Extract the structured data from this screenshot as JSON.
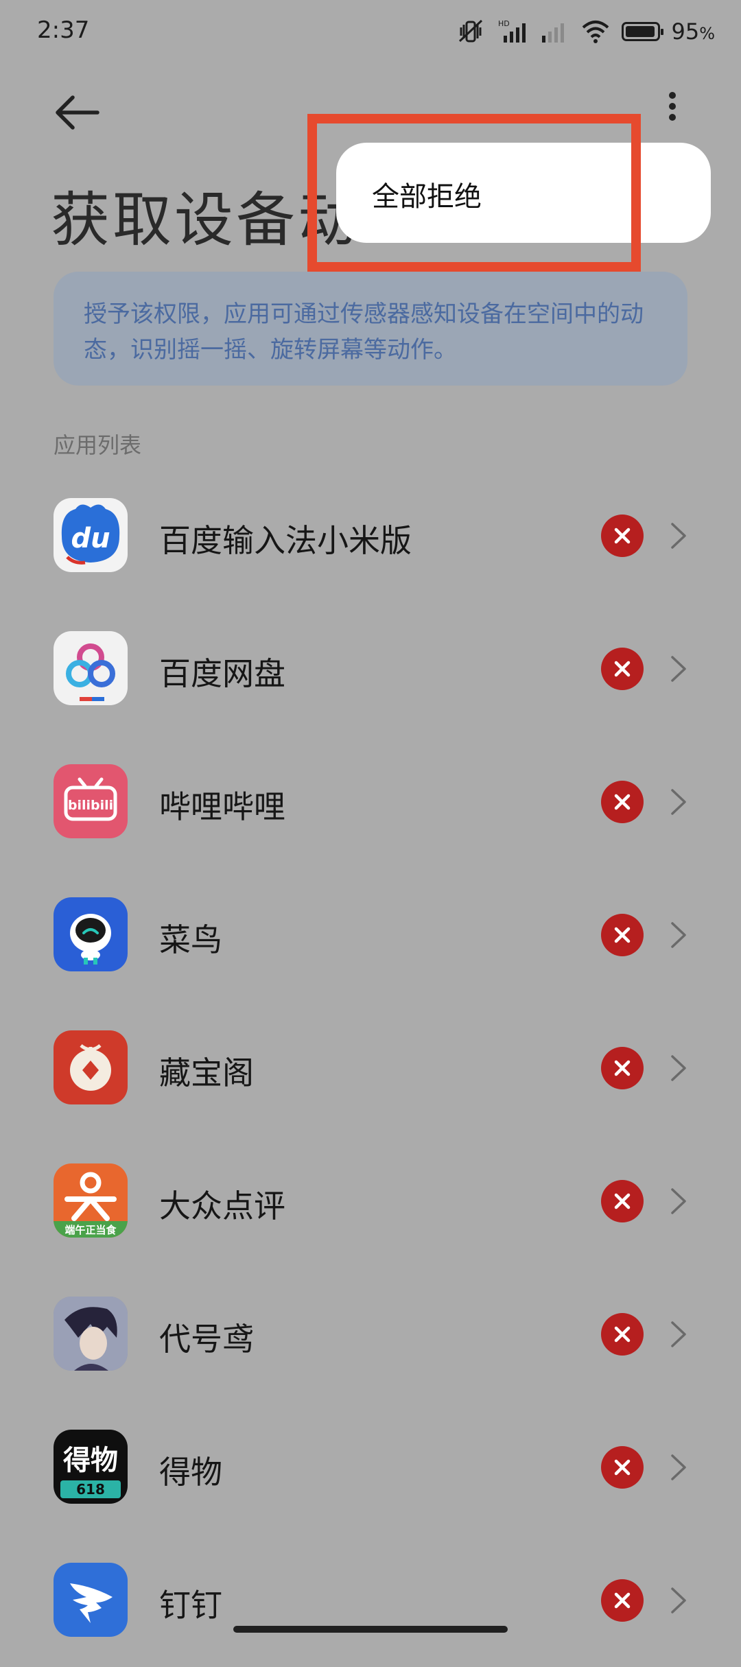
{
  "status_bar": {
    "time": "2:37",
    "battery_percent": "95",
    "battery_unit": "%",
    "battery_level": 0.95
  },
  "header": {
    "title": "获取设备动"
  },
  "info": {
    "text": "授予该权限，应用可通过传感器感知设备在空间中的动态，识别摇一摇、旋转屏幕等动作。"
  },
  "section": {
    "label": "应用列表"
  },
  "apps": [
    {
      "name": "百度输入法小米版",
      "icon": "baidu-input-icon",
      "status": "denied"
    },
    {
      "name": "百度网盘",
      "icon": "baidu-netdisk-icon",
      "status": "denied"
    },
    {
      "name": "哔哩哔哩",
      "icon": "bilibili-icon",
      "status": "denied"
    },
    {
      "name": "菜鸟",
      "icon": "cainiao-icon",
      "status": "denied"
    },
    {
      "name": "藏宝阁",
      "icon": "cangbaoge-icon",
      "status": "denied"
    },
    {
      "name": "大众点评",
      "icon": "dianping-icon",
      "status": "denied"
    },
    {
      "name": "代号鸢",
      "icon": "daihaoyuan-icon",
      "status": "denied"
    },
    {
      "name": "得物",
      "icon": "dewu-icon",
      "status": "denied"
    },
    {
      "name": "钉钉",
      "icon": "dingtalk-icon",
      "status": "denied"
    }
  ],
  "icon_texts": {
    "baidu_input": "du",
    "bilibili": "bilibili",
    "dianping_banner": "端午正当食",
    "dewu_top": "得物",
    "dewu_bottom": "618"
  },
  "popup_menu": {
    "items": [
      {
        "label": "全部拒绝"
      }
    ]
  },
  "colors": {
    "deny": "#b61f1f",
    "highlight": "#e64a2e",
    "info_text": "#4b6aa0"
  }
}
